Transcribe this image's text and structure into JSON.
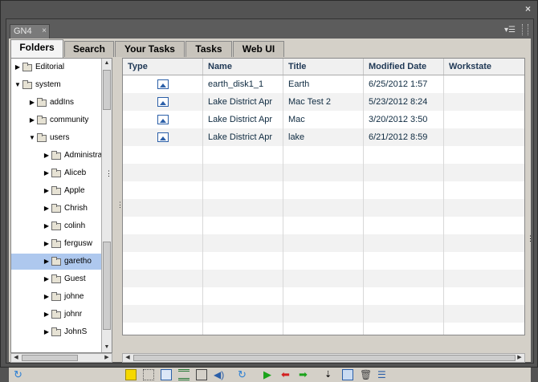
{
  "panel": {
    "tab_label": "GN4",
    "close_glyph": "×"
  },
  "tabs": [
    "Folders",
    "Search",
    "Your Tasks",
    "Tasks",
    "Web UI"
  ],
  "tree": [
    {
      "label": "Editorial",
      "depth": 0,
      "expanded": false
    },
    {
      "label": "system",
      "depth": 0,
      "expanded": true
    },
    {
      "label": "addIns",
      "depth": 1,
      "expanded": false
    },
    {
      "label": "community",
      "depth": 1,
      "expanded": false
    },
    {
      "label": "users",
      "depth": 1,
      "expanded": true
    },
    {
      "label": "Administrator",
      "depth": 2,
      "expanded": false
    },
    {
      "label": "Aliceb",
      "depth": 2,
      "expanded": false
    },
    {
      "label": "Apple",
      "depth": 2,
      "expanded": false
    },
    {
      "label": "Chrish",
      "depth": 2,
      "expanded": false
    },
    {
      "label": "colinh",
      "depth": 2,
      "expanded": false
    },
    {
      "label": "fergusw",
      "depth": 2,
      "expanded": false
    },
    {
      "label": "garetho",
      "depth": 2,
      "expanded": false,
      "selected": true
    },
    {
      "label": "Guest",
      "depth": 2,
      "expanded": false
    },
    {
      "label": "johne",
      "depth": 2,
      "expanded": false
    },
    {
      "label": "johnr",
      "depth": 2,
      "expanded": false
    },
    {
      "label": "JohnS",
      "depth": 2,
      "expanded": false
    }
  ],
  "columns": [
    "Type",
    "Name",
    "Title",
    "Modified Date",
    "Workstate"
  ],
  "rows": [
    {
      "name": "earth_disk1_1",
      "title": "Earth",
      "modified": "6/25/2012 1:57"
    },
    {
      "name": "Lake District Apr",
      "title": "Mac Test 2",
      "modified": "5/23/2012 8:24"
    },
    {
      "name": "Lake District Apr",
      "title": "Mac",
      "modified": "3/20/2012 3:50"
    },
    {
      "name": "Lake District Apr",
      "title": "lake",
      "modified": "6/21/2012 8:59"
    }
  ],
  "scroll_dots": "…"
}
